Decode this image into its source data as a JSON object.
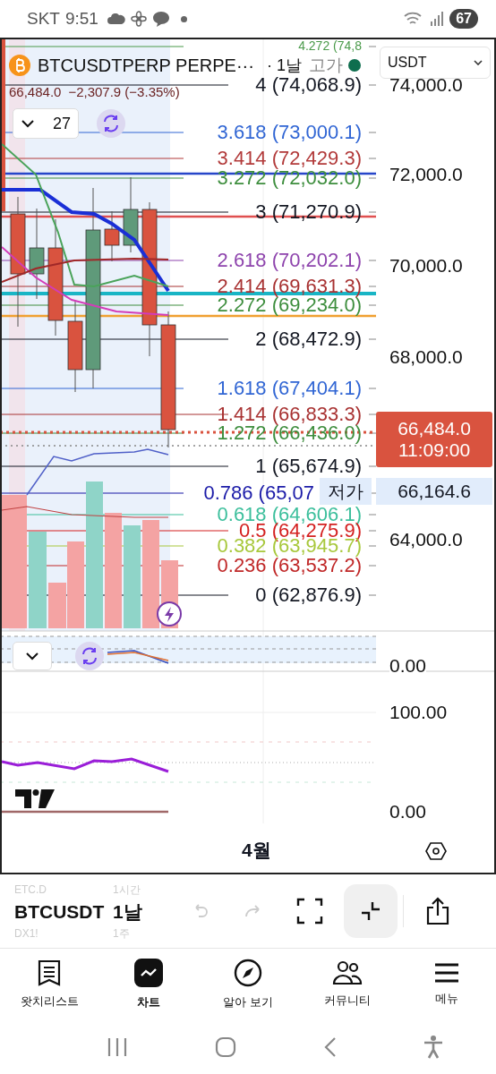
{
  "status_bar": {
    "carrier": "SKT",
    "time": "9:51",
    "battery": "67"
  },
  "chart": {
    "symbol": "BTCUSDTPERP PERPE···",
    "interval": "· 1날",
    "high_label": "고가",
    "currency": "USDT",
    "last_price": "66,484.0",
    "change": "−2,307.9 (−3.35%)",
    "indicator_count": "27",
    "price_axis": [
      "74,000.0",
      "72,000.0",
      "70,000.0",
      "68,000.0",
      "64,000.0"
    ],
    "price_tag": {
      "price": "66,484.0",
      "countdown": "11:09:00"
    },
    "low_tag": {
      "label": "저가",
      "price": "66,164.6"
    },
    "fib_levels": [
      {
        "label": "4.272 (74,8",
        "color": "#4a9a4a"
      },
      {
        "label": "4 (74,068.9)",
        "color": "#131722"
      },
      {
        "label": "3.618 (73,000.1)",
        "color": "#3166d4"
      },
      {
        "label": "3.414 (72,429.3)",
        "color": "#b23a3a"
      },
      {
        "label": "3.272 (72,032.0)",
        "color": "#3e8e3e"
      },
      {
        "label": "3 (71,270.9)",
        "color": "#131722"
      },
      {
        "label": "2.618 (70,202.1)",
        "color": "#8e44ad"
      },
      {
        "label": "2.414 (69,631.3)",
        "color": "#a83232"
      },
      {
        "label": "2.272 (69,234.0)",
        "color": "#3e8e3e"
      },
      {
        "label": "2 (68,472.9)",
        "color": "#131722"
      },
      {
        "label": "1.618 (67,404.1)",
        "color": "#3166d4"
      },
      {
        "label": "1.414 (66,833.3)",
        "color": "#a83232"
      },
      {
        "label": "1.272 (66,436.0)",
        "color": "#3e8e3e"
      },
      {
        "label": "1 (65,674.9)",
        "color": "#131722"
      },
      {
        "label": "0.786 (65,07",
        "color": "#1a1aa8"
      },
      {
        "label": "0.618 (64,606.1)",
        "color": "#3cbf9c"
      },
      {
        "label": "0.5 (64,275.9)",
        "color": "#d42020"
      },
      {
        "label": "0.382 (63,945.7)",
        "color": "#a8c83c"
      },
      {
        "label": "0.236 (63,537.2)",
        "color": "#c02828"
      },
      {
        "label": "0 (62,876.9)",
        "color": "#131722"
      }
    ],
    "oscillator_axis": "0.00",
    "rsi_axis": [
      "100.00",
      "0.00"
    ],
    "time_axis": "4월"
  },
  "symbol_picker": [
    {
      "label": "ETC.D",
      "selected": false
    },
    {
      "label": "BTCUSDT",
      "selected": true
    },
    {
      "label": "DX1!",
      "selected": false
    }
  ],
  "interval_picker": [
    {
      "label": "1시간",
      "selected": false
    },
    {
      "label": "1날",
      "selected": true
    },
    {
      "label": "1주",
      "selected": false
    }
  ],
  "tools": [
    {
      "kind": "undo",
      "disabled": true,
      "selected": false
    },
    {
      "kind": "redo",
      "disabled": true,
      "selected": false
    },
    {
      "kind": "fullscreen",
      "disabled": false,
      "selected": false
    },
    {
      "kind": "collapse",
      "disabled": false,
      "selected": true
    },
    {
      "kind": "share",
      "disabled": false,
      "selected": false
    }
  ],
  "nav": [
    {
      "kind": "watchlist",
      "label": "왓치리스트",
      "selected": false
    },
    {
      "kind": "chart",
      "label": "차트",
      "selected": true
    },
    {
      "kind": "explore",
      "label": "알아 보기",
      "selected": false
    },
    {
      "kind": "community",
      "label": "커뮤니티",
      "selected": false
    },
    {
      "kind": "menu",
      "label": "메뉴",
      "selected": false
    }
  ]
}
